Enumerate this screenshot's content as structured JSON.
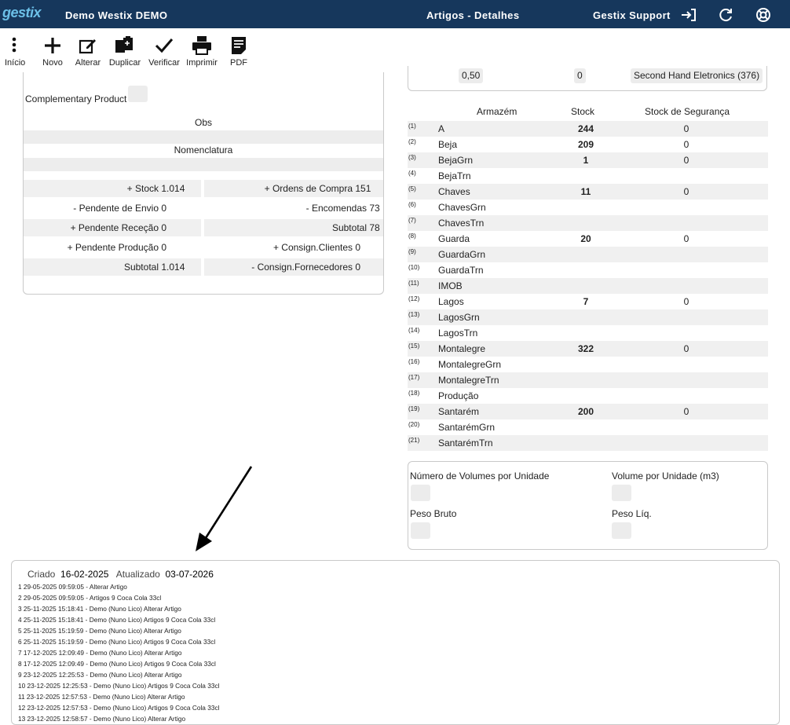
{
  "topbar": {
    "logo": "gestix",
    "company": "Demo Westix DEMO",
    "page_title": "Artigos - Detalhes",
    "user": "Gestix Support"
  },
  "toolbar": {
    "home": "Início",
    "new": "Novo",
    "edit": "Alterar",
    "duplicate": "Duplicar",
    "verify": "Verificar",
    "print": "Imprimir",
    "pdf": "PDF"
  },
  "left": {
    "complementary_label": "Complementary Product",
    "obs_label": "Obs",
    "nomenclatura_label": "Nomenclatura",
    "summary_left": [
      {
        "label": "+ Stock",
        "value": "1.014"
      },
      {
        "label": "- Pendente de Envio",
        "value": "0"
      },
      {
        "label": "+ Pendente Receção",
        "value": "0"
      },
      {
        "label": "+ Pendente Produção",
        "value": "0"
      },
      {
        "label": "Subtotal",
        "value": "1.014"
      }
    ],
    "summary_right": [
      {
        "label": "+ Ordens de Compra",
        "value": "151"
      },
      {
        "label": "- Encomendas",
        "value": "73"
      },
      {
        "label": "Subtotal",
        "value": "78"
      },
      {
        "label": "+ Consign.Clientes",
        "value": "0"
      },
      {
        "label": "- Consign.Fornecedores",
        "value": "0"
      }
    ]
  },
  "right": {
    "top_values": [
      "0,50",
      "0",
      "Second Hand Eletronics (376)"
    ],
    "stock_headers": {
      "warehouse": "Armazém",
      "stock": "Stock",
      "safety": "Stock de Segurança"
    },
    "warehouses": [
      {
        "num": "(1)",
        "name": "A",
        "stock": "244",
        "safety": "0"
      },
      {
        "num": "(2)",
        "name": "Beja",
        "stock": "209",
        "safety": "0"
      },
      {
        "num": "(3)",
        "name": "BejaGrn",
        "stock": "1",
        "safety": "0"
      },
      {
        "num": "(4)",
        "name": "BejaTrn",
        "stock": "",
        "safety": ""
      },
      {
        "num": "(5)",
        "name": "Chaves",
        "stock": "11",
        "safety": "0"
      },
      {
        "num": "(6)",
        "name": "ChavesGrn",
        "stock": "",
        "safety": ""
      },
      {
        "num": "(7)",
        "name": "ChavesTrn",
        "stock": "",
        "safety": ""
      },
      {
        "num": "(8)",
        "name": "Guarda",
        "stock": "20",
        "safety": "0"
      },
      {
        "num": "(9)",
        "name": "GuardaGrn",
        "stock": "",
        "safety": ""
      },
      {
        "num": "(10)",
        "name": "GuardaTrn",
        "stock": "",
        "safety": ""
      },
      {
        "num": "(11)",
        "name": "IMOB",
        "stock": "",
        "safety": ""
      },
      {
        "num": "(12)",
        "name": "Lagos",
        "stock": "7",
        "safety": "0"
      },
      {
        "num": "(13)",
        "name": "LagosGrn",
        "stock": "",
        "safety": ""
      },
      {
        "num": "(14)",
        "name": "LagosTrn",
        "stock": "",
        "safety": ""
      },
      {
        "num": "(15)",
        "name": "Montalegre",
        "stock": "322",
        "safety": "0"
      },
      {
        "num": "(16)",
        "name": "MontalegreGrn",
        "stock": "",
        "safety": ""
      },
      {
        "num": "(17)",
        "name": "MontalegreTrn",
        "stock": "",
        "safety": ""
      },
      {
        "num": "(18)",
        "name": "Produção",
        "stock": "",
        "safety": ""
      },
      {
        "num": "(19)",
        "name": "Santarém",
        "stock": "200",
        "safety": "0"
      },
      {
        "num": "(20)",
        "name": "SantarémGrn",
        "stock": "",
        "safety": ""
      },
      {
        "num": "(21)",
        "name": "SantarémTrn",
        "stock": "",
        "safety": ""
      }
    ],
    "volumes_label": "Número de Volumes por Unidade",
    "volume_unit_label": "Volume por Unidade (m3)",
    "gross_weight_label": "Peso Bruto",
    "net_weight_label": "Peso Líq."
  },
  "log": {
    "created_label": "Criado",
    "created_value": "16-02-2025",
    "updated_label": "Atualizado",
    "updated_value": "03-07-2026",
    "lines": [
      "1 29-05-2025 09:59:05 - Alterar Artigo",
      "2 29-05-2025 09:59:05 - Artigos 9 Coca Cola 33cl",
      "3 25-11-2025 15:18:41 - Demo (Nuno Lico) Alterar Artigo",
      "4 25-11-2025 15:18:41 - Demo (Nuno Lico) Artigos 9 Coca Cola 33cl",
      "5 25-11-2025 15:19:59 - Demo (Nuno Lico) Alterar Artigo",
      "6 25-11-2025 15:19:59 - Demo (Nuno Lico) Artigos 9 Coca Cola 33cl",
      "7 17-12-2025 12:09:49 - Demo (Nuno Lico) Alterar Artigo",
      "8 17-12-2025 12:09:49 - Demo (Nuno Lico) Artigos 9 Coca Cola 33cl",
      "9 23-12-2025 12:25:53 - Demo (Nuno Lico) Alterar Artigo",
      "10 23-12-2025 12:25:53 - Demo (Nuno Lico) Artigos 9 Coca Cola 33cl",
      "11 23-12-2025 12:57:53 - Demo (Nuno Lico) Alterar Artigo",
      "12 23-12-2025 12:57:53 - Demo (Nuno Lico) Artigos 9 Coca Cola 33cl",
      "13 23-12-2025 12:58:57 - Demo (Nuno Lico) Alterar Artigo"
    ]
  }
}
